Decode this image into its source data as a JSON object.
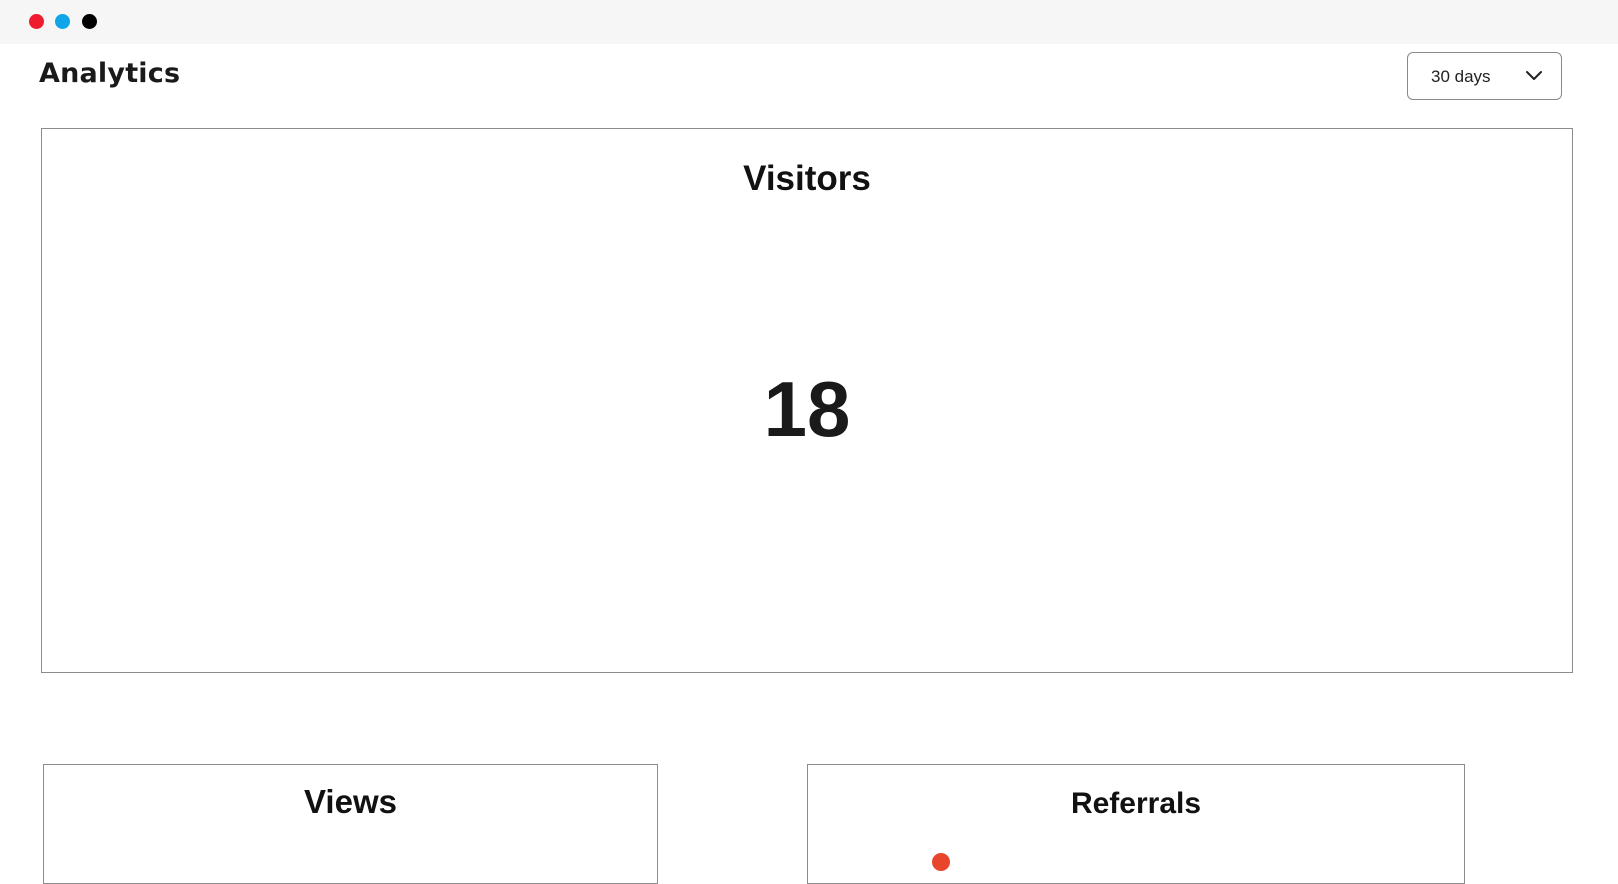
{
  "window": {
    "controls": [
      {
        "name": "close",
        "color": "#ee1c2e"
      },
      {
        "name": "minimize",
        "color": "#0ea5e9"
      },
      {
        "name": "maximize",
        "color": "#000000"
      }
    ]
  },
  "header": {
    "title": "Analytics",
    "range_select": {
      "value": "30 days",
      "icon": "chevron-down-icon"
    }
  },
  "cards": {
    "visitors": {
      "title": "Visitors",
      "value": "18"
    },
    "views": {
      "title": "Views"
    },
    "referrals": {
      "title": "Referrals",
      "marker_color": "#e8452c"
    }
  }
}
